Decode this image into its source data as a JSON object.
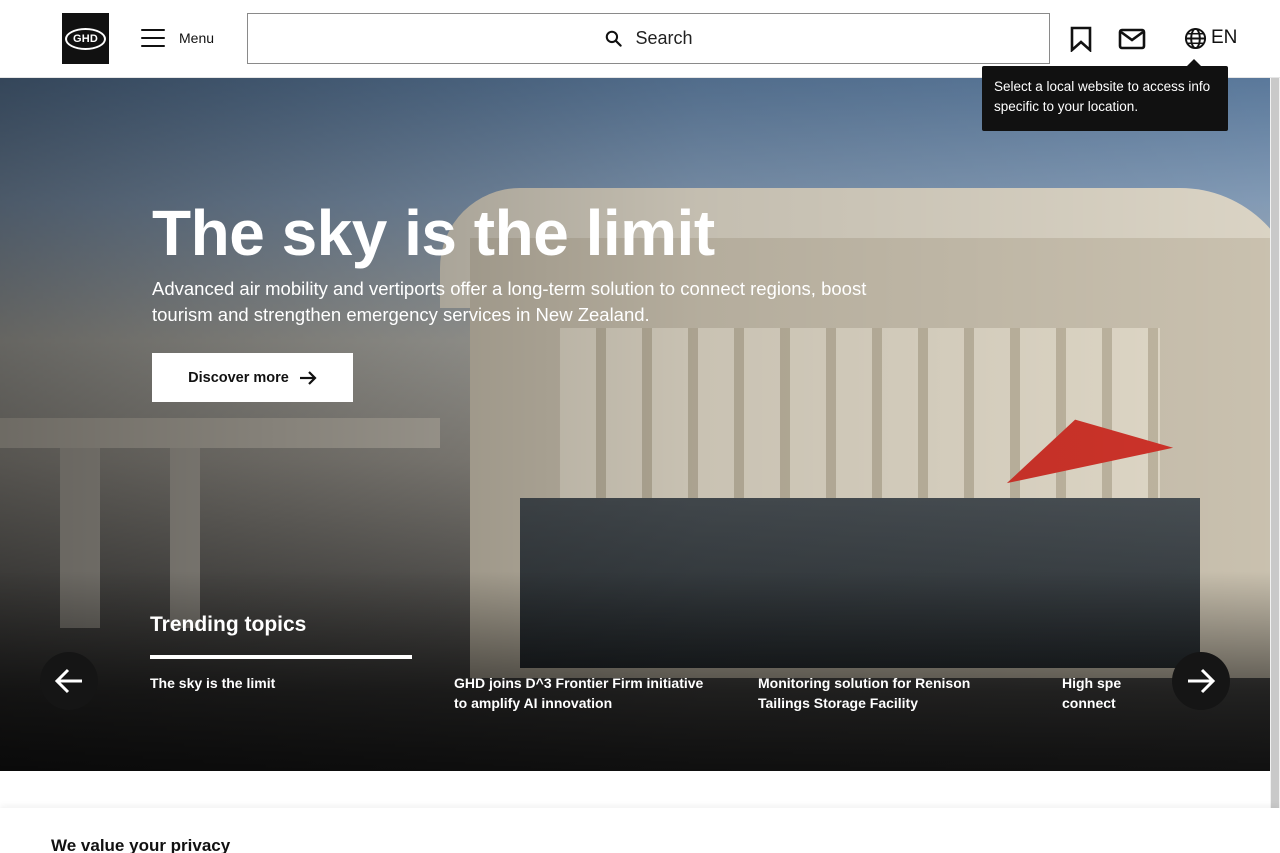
{
  "header": {
    "logo_text": "GHD",
    "menu_label": "Menu",
    "search_label": "Search",
    "language_label": "EN",
    "icons": {
      "logo": "ghd-logo",
      "menu": "hamburger-icon",
      "search": "search-icon",
      "bookmark": "bookmark-icon",
      "mail": "mail-icon",
      "globe": "globe-icon"
    }
  },
  "tooltip": {
    "text": "Select a local website to access info specific to your location."
  },
  "hero": {
    "title": "The sky is the limit",
    "subtitle": "Advanced air mobility and vertiports offer a long-term solution to connect regions, boost tourism and strengthen emergency services in New Zealand.",
    "cta_label": "Discover more",
    "cta_icon": "arrow-right-icon"
  },
  "trending": {
    "title": "Trending topics",
    "items": [
      {
        "label": "The sky is the limit",
        "active": true
      },
      {
        "label": "GHD joins D^3 Frontier Firm initiative to amplify AI innovation",
        "active": false
      },
      {
        "label": "Monitoring solution for Renison Tailings Storage Facility",
        "active": false
      },
      {
        "label": "High spe connect",
        "active": false
      }
    ],
    "prev_icon": "arrow-left-icon",
    "next_icon": "arrow-right-icon"
  },
  "privacy": {
    "title": "We value your privacy"
  },
  "colors": {
    "header_bg": "#ffffff",
    "text": "#111111",
    "tooltip_bg": "#111111",
    "cta_bg": "#ffffff",
    "accent_red": "#d9362c"
  }
}
